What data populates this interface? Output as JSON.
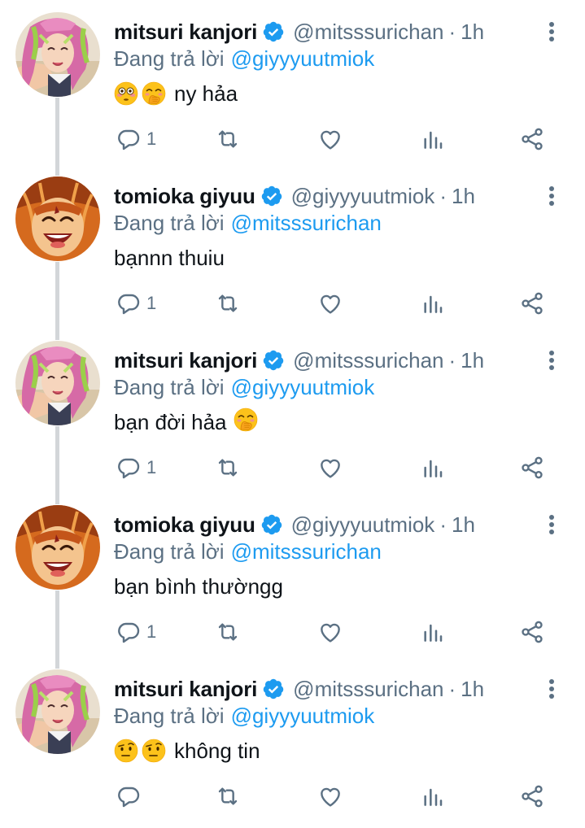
{
  "tweets": [
    {
      "name": "mitsuri kanjori",
      "handle": "@mitsssurichan",
      "separator": "·",
      "time": "1h",
      "reply_prefix": "Đang trả lời",
      "reply_to": "@giyyyuutmiok",
      "emojis": [
        "flushed-face-emoji",
        "face-with-hand-over-mouth-emoji"
      ],
      "text": "ny hảa",
      "emoji_after": "",
      "reply_count": "1",
      "avatar": "pink-hair-anime-girl",
      "author": "mitsuri"
    },
    {
      "name": "tomioka giyuu",
      "handle": "@giyyyuutmiok",
      "separator": "·",
      "time": "1h",
      "reply_prefix": "Đang trả lời",
      "reply_to": "@mitsssurichan",
      "emojis": [],
      "text": "bạnnn thuiu",
      "emoji_after": "",
      "reply_count": "1",
      "avatar": "orange-hair-anime-boy",
      "author": "giyuu"
    },
    {
      "name": "mitsuri kanjori",
      "handle": "@mitsssurichan",
      "separator": "·",
      "time": "1h",
      "reply_prefix": "Đang trả lời",
      "reply_to": "@giyyyuutmiok",
      "emojis": [],
      "text": "bạn đời hảa",
      "emoji_after": "face-with-hand-over-mouth-emoji",
      "reply_count": "1",
      "avatar": "pink-hair-anime-girl",
      "author": "mitsuri"
    },
    {
      "name": "tomioka giyuu",
      "handle": "@giyyyuutmiok",
      "separator": "·",
      "time": "1h",
      "reply_prefix": "Đang trả lời",
      "reply_to": "@mitsssurichan",
      "emojis": [],
      "text": "bạn bình thườngg",
      "emoji_after": "",
      "reply_count": "1",
      "avatar": "orange-hair-anime-boy",
      "author": "giyuu"
    },
    {
      "name": "mitsuri kanjori",
      "handle": "@mitsssurichan",
      "separator": "·",
      "time": "1h",
      "reply_prefix": "Đang trả lời",
      "reply_to": "@giyyyuutmiok",
      "emojis": [
        "face-with-raised-eyebrow-emoji",
        "face-with-raised-eyebrow-emoji"
      ],
      "text": "không tin",
      "emoji_after": "",
      "reply_count": "",
      "avatar": "pink-hair-anime-girl",
      "author": "mitsuri"
    }
  ],
  "icons": {
    "reply": "reply-icon",
    "retweet": "retweet-icon",
    "like": "heart-icon",
    "analytics": "analytics-icon",
    "share": "share-icon",
    "verified": "verified-badge-icon",
    "more": "more-options-icon"
  },
  "colors": {
    "name": "#0f1419",
    "secondary": "#5b7083",
    "link": "#1d9bf0",
    "verified": "#1d9bf0",
    "thread_line": "#d3d6d9",
    "background": "#ffffff"
  }
}
